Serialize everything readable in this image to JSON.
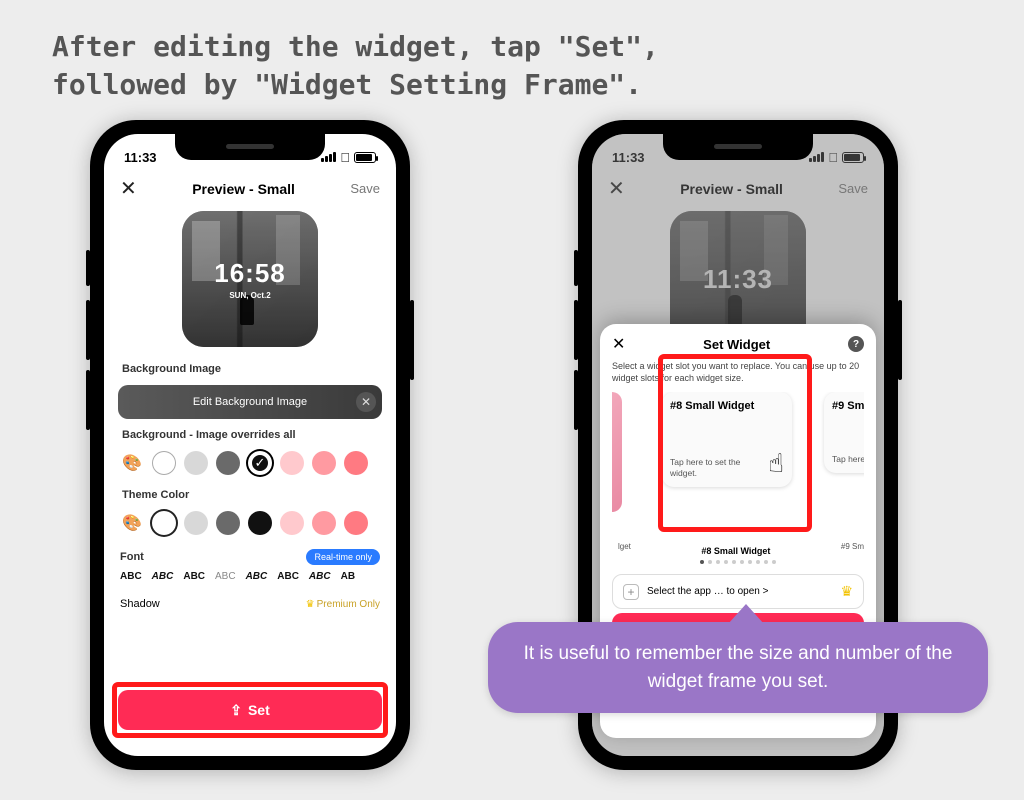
{
  "headline_l1": "After editing the widget, tap \"Set\",",
  "headline_l2": "followed by \"Widget Setting Frame\".",
  "status_time": "11:33",
  "nav": {
    "title": "Preview - Small",
    "save": "Save"
  },
  "widget_preview": {
    "time": "16:58",
    "date": "SUN, Oct.2"
  },
  "widget_preview_right_time": "11:33",
  "sections": {
    "bg_image": "Background Image",
    "bg_edit": "Edit Background Image",
    "bg_overrides": "Background - Image overrides all",
    "theme_color": "Theme Color",
    "font": "Font",
    "realtime": "Real-time only",
    "shadow": "Shadow",
    "premium": "Premium Only"
  },
  "font_samples": [
    "ABC",
    "ABC",
    "ABC",
    "ABC",
    "ABC",
    "ABC",
    "ABC",
    "AB"
  ],
  "set_button": "Set",
  "sheet": {
    "title": "Set Widget",
    "desc": "Select a widget slot you want to replace. You can use up to 20 widget slots for each widget size.",
    "slot8_title": "#8 Small Widget",
    "slot9_title": "#9 Sm",
    "tap_text": "Tap here to set the widget.",
    "slot8_caption": "#8 Small Widget",
    "slot9_caption": "#9 Sm",
    "left_caption": "lget",
    "select_app": "Select the app",
    "select_app_suffix": "to open >"
  },
  "progress_end": "0.0",
  "callout": "It is useful to remember the size and number of the widget frame you set.",
  "colors": {
    "bg_swatches": [
      "#ffffff",
      "#d8d8d8",
      "#6a6a6a",
      "#111111",
      "#ffc9cd",
      "#ff9aa1",
      "#ff7a82"
    ],
    "theme_swatches": [
      "#ffffff",
      "#d8d8d8",
      "#6a6a6a",
      "#111111",
      "#ffc9cd",
      "#ff9aa1",
      "#ff7a82"
    ]
  }
}
